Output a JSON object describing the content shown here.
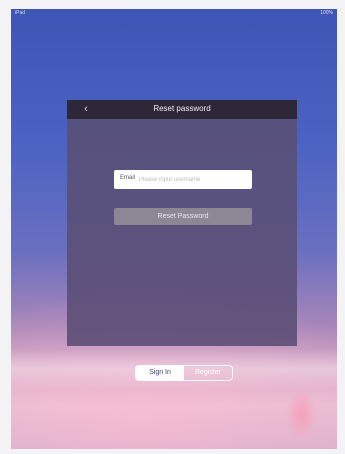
{
  "status_bar": {
    "left": "iPad",
    "right": "100%"
  },
  "dialog": {
    "title": "Reset password",
    "back_icon": "chevron-left-icon",
    "email_label": "Email",
    "email_placeholder": "Please input username",
    "email_value": "",
    "reset_button_label": "Reset Password"
  },
  "auth_switch": {
    "sign_in_label": "Sign In",
    "register_label": "Register"
  }
}
